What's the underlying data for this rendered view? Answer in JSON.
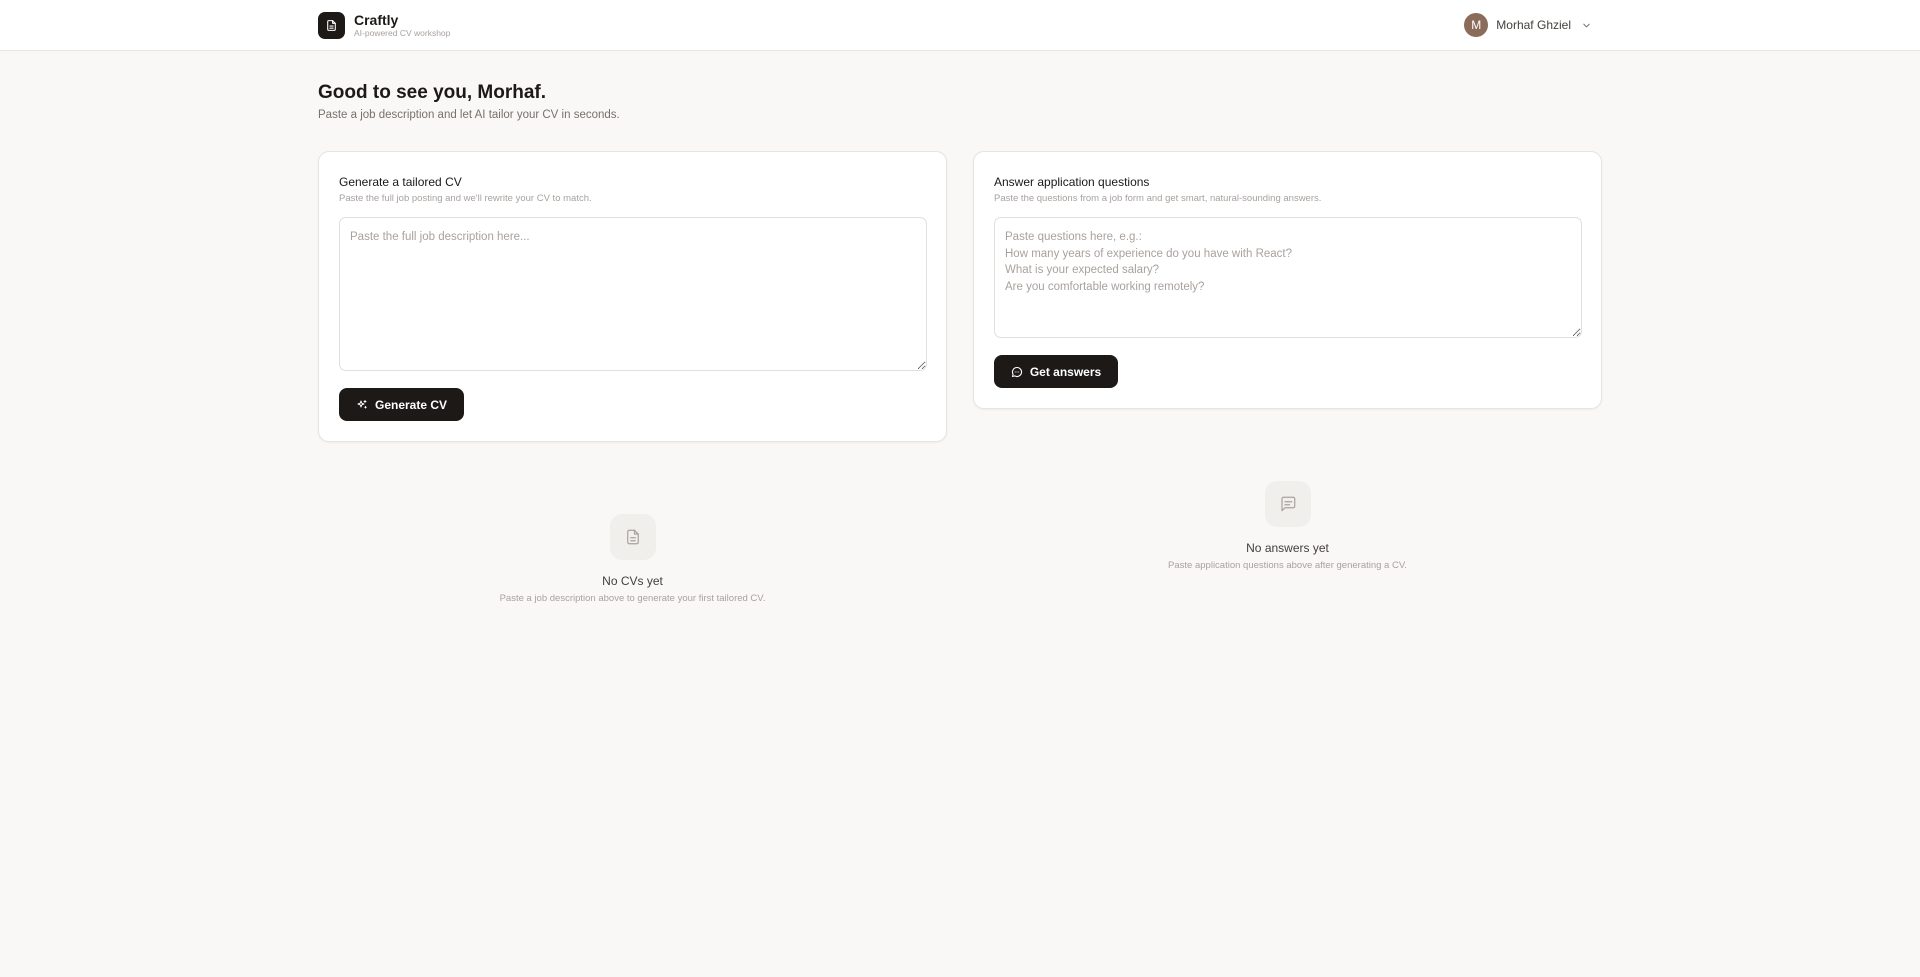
{
  "brand": {
    "name": "Craftly",
    "tagline": "AI-powered CV workshop"
  },
  "user": {
    "initial": "M",
    "name": "Morhaf Ghziel"
  },
  "greeting": {
    "title": "Good to see you, Morhaf.",
    "subtitle": "Paste a job description and let AI tailor your CV in seconds."
  },
  "cv_card": {
    "title": "Generate a tailored CV",
    "subtitle": "Paste the full job posting and we'll rewrite your CV to match.",
    "placeholder": "Paste the full job description here...",
    "button_label": "Generate CV"
  },
  "qa_card": {
    "title": "Answer application questions",
    "subtitle": "Paste the questions from a job form and get smart, natural-sounding answers.",
    "placeholder": "Paste questions here, e.g.:\nHow many years of experience do you have with React?\nWhat is your expected salary?\nAre you comfortable working remotely?",
    "button_label": "Get answers"
  },
  "empty_cvs": {
    "title": "No CVs yet",
    "subtitle": "Paste a job description above to generate your first tailored CV."
  },
  "empty_answers": {
    "title": "No answers yet",
    "subtitle": "Paste application questions above after generating a CV."
  },
  "icons": {
    "logo": "document-icon",
    "chevron": "chevron-down-icon",
    "generate": "sparkles-icon",
    "answers": "chat-bubble-icon",
    "empty_cv": "document-icon",
    "empty_answers": "message-square-icon"
  },
  "colors": {
    "accent": "#1c1917",
    "background": "#f9f8f6",
    "avatar": "#8b6b5a"
  }
}
